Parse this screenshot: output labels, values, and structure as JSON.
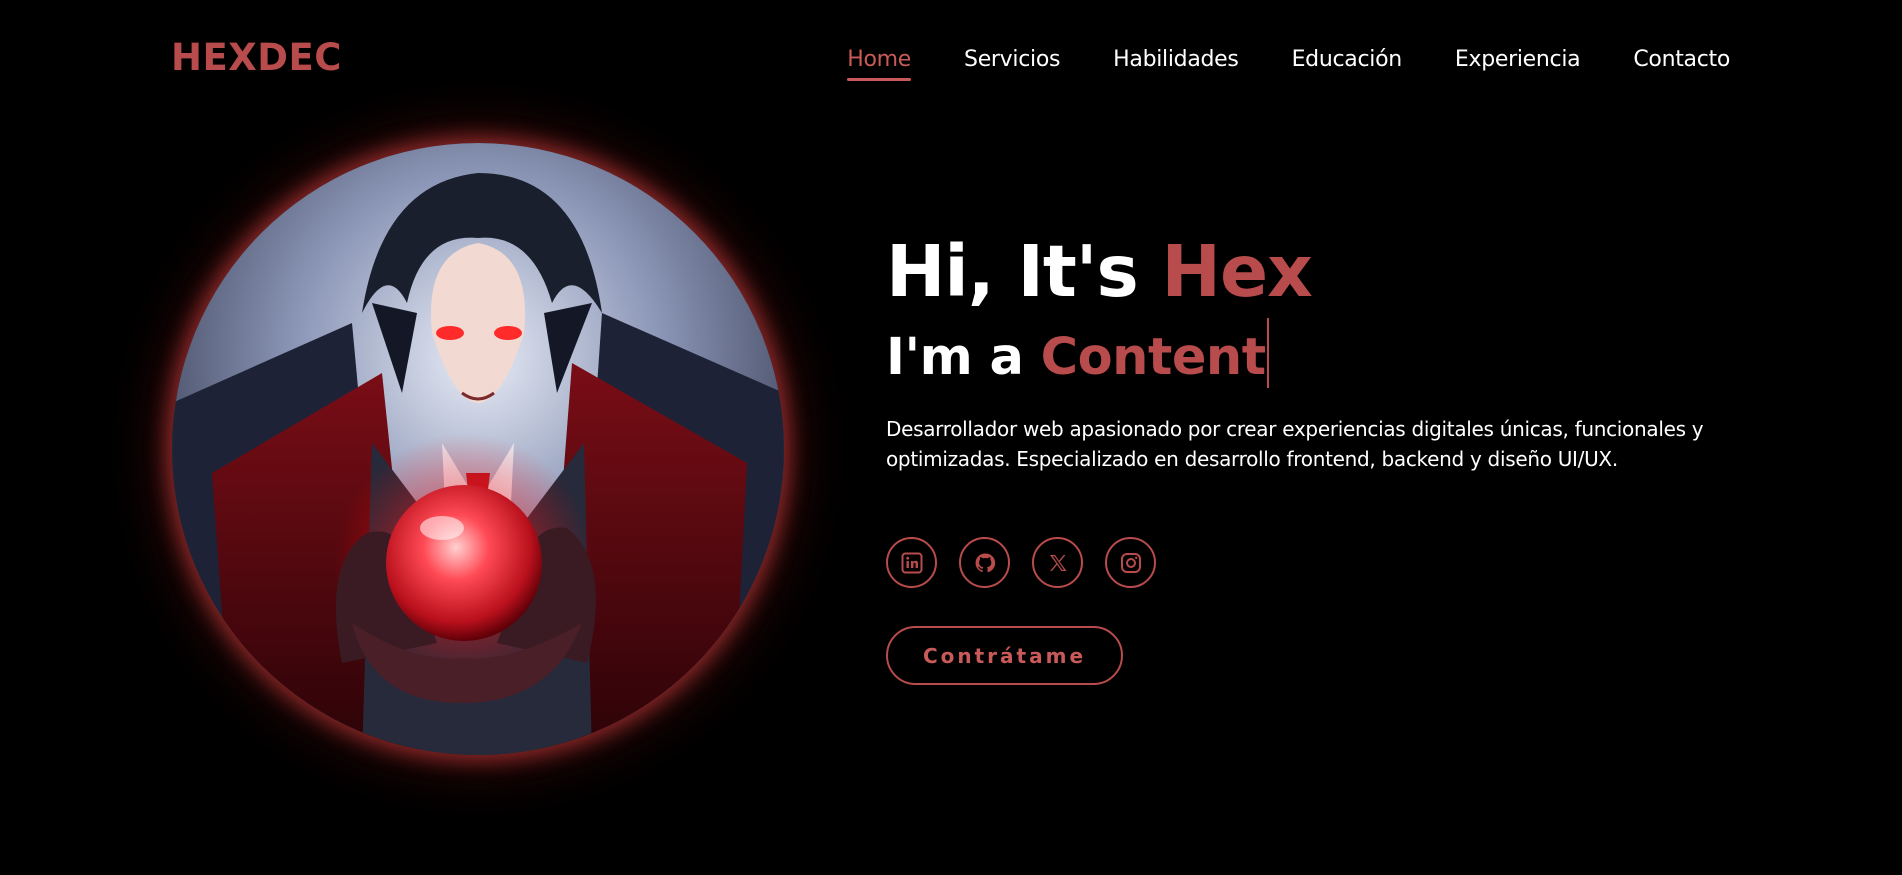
{
  "brand": {
    "logo": "HEXDEC",
    "accent_color": "#b84b4b"
  },
  "nav": {
    "items": [
      {
        "label": "Home",
        "active": true
      },
      {
        "label": "Servicios",
        "active": false
      },
      {
        "label": "Habilidades",
        "active": false
      },
      {
        "label": "Educación",
        "active": false
      },
      {
        "label": "Experiencia",
        "active": false
      },
      {
        "label": "Contacto",
        "active": false
      }
    ]
  },
  "hero": {
    "greeting_prefix": "Hi, It's ",
    "greeting_name": "Hex",
    "role_prefix": "I'm a ",
    "role_typed": "Content",
    "description": "Desarrollador web apasionado por crear experiencias digitales únicas, funcionales y optimizadas. Especializado en desarrollo frontend, backend y diseño UI/UX.",
    "cta_label": "Contrátame",
    "avatar": "anime-vampire-with-glowing-red-orb"
  },
  "socials": [
    {
      "icon": "linkedin-icon"
    },
    {
      "icon": "github-icon"
    },
    {
      "icon": "x-icon"
    },
    {
      "icon": "instagram-icon"
    }
  ]
}
